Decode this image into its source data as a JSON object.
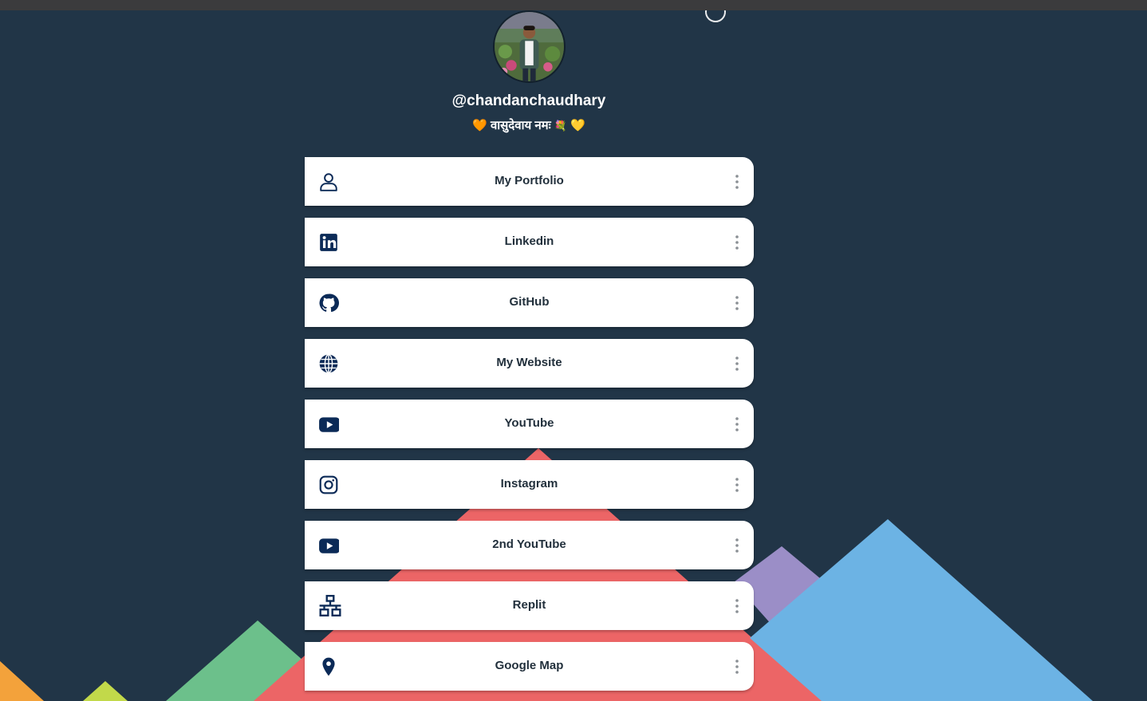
{
  "profile": {
    "handle": "@chandanchaudhary",
    "bio": {
      "heart_left": "🧡",
      "text": "वासुदेवाय नमः",
      "flower": "💐",
      "heart_right": "💛"
    }
  },
  "links": [
    {
      "label": "My Portfolio",
      "icon": "person-icon"
    },
    {
      "label": "Linkedin",
      "icon": "linkedin-icon"
    },
    {
      "label": "GitHub",
      "icon": "github-icon"
    },
    {
      "label": "My Website",
      "icon": "globe-icon"
    },
    {
      "label": "YouTube",
      "icon": "youtube-icon"
    },
    {
      "label": "Instagram",
      "icon": "instagram-icon"
    },
    {
      "label": "2nd YouTube",
      "icon": "youtube-icon"
    },
    {
      "label": "Replit",
      "icon": "network-icon"
    },
    {
      "label": "Google Map",
      "icon": "map-pin-icon"
    }
  ],
  "colors": {
    "background": "#213547",
    "card": "#ffffff",
    "icon": "#0b2a57",
    "text": "#22303c",
    "more_dots": "#8a8f94"
  }
}
